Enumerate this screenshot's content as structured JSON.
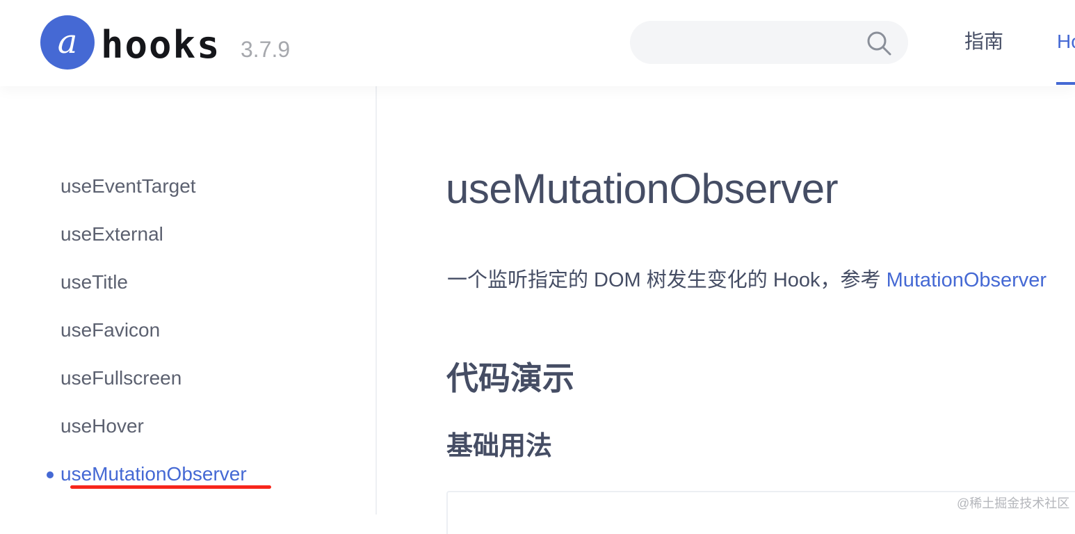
{
  "header": {
    "logo_letter": "a",
    "logo_word": "hooks",
    "version": "3.7.9",
    "search": {
      "placeholder": "",
      "value": ""
    },
    "nav": [
      {
        "label": "指南"
      },
      {
        "label": "Hooks"
      }
    ]
  },
  "sidebar": {
    "items": [
      {
        "label": "useEventTarget",
        "active": false
      },
      {
        "label": "useExternal",
        "active": false
      },
      {
        "label": "useTitle",
        "active": false
      },
      {
        "label": "useFavicon",
        "active": false
      },
      {
        "label": "useFullscreen",
        "active": false
      },
      {
        "label": "useHover",
        "active": false
      },
      {
        "label": "useMutationObserver",
        "active": true
      }
    ]
  },
  "main": {
    "title": "useMutationObserver",
    "description_prefix": "一个监听指定的 DOM 树发生变化的 Hook，参考 ",
    "description_link": "MutationObserver",
    "section_heading": "代码演示",
    "subsection_heading": "基础用法"
  },
  "watermark": "@稀土掘金技术社区",
  "colors": {
    "accent": "#4569d4",
    "text": "#454d64",
    "annotation_underline": "#f7261b"
  },
  "icons": {
    "search": "search-icon"
  }
}
